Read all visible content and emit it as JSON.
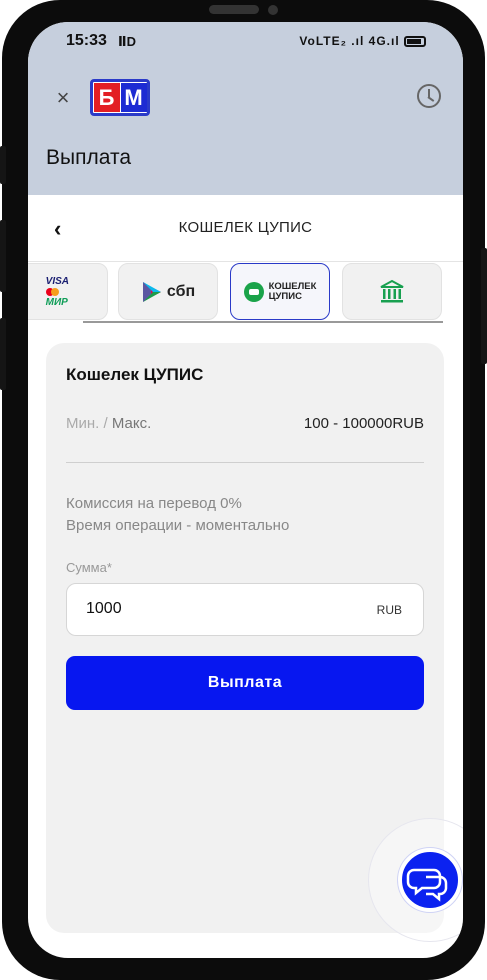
{
  "status_bar": {
    "time": "15:33",
    "left_icons": "ⅡD",
    "right_icons": "VoLTE₂ .ıl 4G.ıl"
  },
  "header": {
    "close_label": "×",
    "logo_letters": [
      "Б",
      "М"
    ],
    "title": "Выплата"
  },
  "subheader": {
    "back_label": "‹",
    "title": "КОШЕЛЕК ЦУПИС"
  },
  "payment_methods": [
    {
      "id": "cards",
      "lines": [
        "VISA",
        "МИР"
      ],
      "active": false
    },
    {
      "id": "sbp",
      "label": "сбп",
      "active": false
    },
    {
      "id": "cupis",
      "lines": [
        "КОШЕЛЕК",
        "ЦУПИС"
      ],
      "active": true
    },
    {
      "id": "bank",
      "active": false
    }
  ],
  "card": {
    "title": "Кошелек ЦУПИС",
    "min_label": "Мин. /",
    "max_label": "Макс.",
    "range": "100 - 100000RUB",
    "commission": "Комиссия на перевод 0%",
    "time": "Время операции - моментально",
    "amount_label": "Сумма*",
    "amount_value": "1000",
    "currency": "RUB",
    "submit_label": "Выплата"
  },
  "colors": {
    "header_bg": "#c6cfdd",
    "accent": "#0717f0",
    "logo_red": "#e31e24",
    "logo_blue": "#1d2bd3",
    "cupis_green": "#1aa34a"
  },
  "icons": [
    "close-icon",
    "history-clock-icon",
    "back-chevron-icon",
    "bank-icon",
    "chat-icon",
    "battery-icon"
  ]
}
